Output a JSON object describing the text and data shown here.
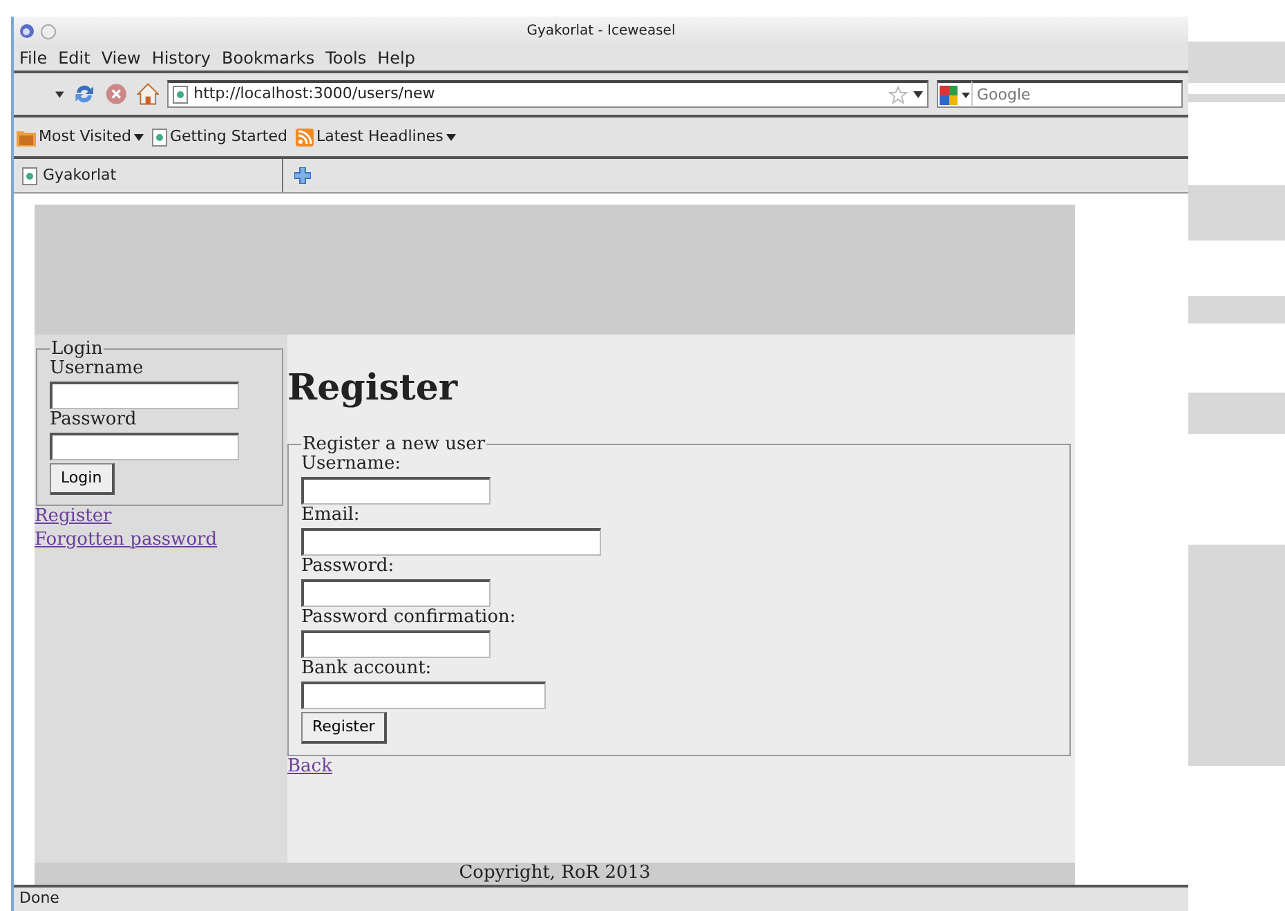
{
  "window": {
    "title": "Gyakorlat - Iceweasel"
  },
  "menu": [
    "File",
    "Edit",
    "View",
    "History",
    "Bookmarks",
    "Tools",
    "Help"
  ],
  "navigation": {
    "url": "http://localhost:3000/users/new",
    "search_placeholder": "Google"
  },
  "bookmarks": [
    {
      "label": "Most Visited",
      "kind": "folder",
      "dropdown": true
    },
    {
      "label": "Getting Started",
      "kind": "page",
      "dropdown": false
    },
    {
      "label": "Latest Headlines",
      "kind": "feed",
      "dropdown": true
    }
  ],
  "tabs": [
    {
      "label": "Gyakorlat",
      "selected": true
    }
  ],
  "sidebar": {
    "login": {
      "legend": "Login",
      "fields": [
        "Username",
        "Password"
      ],
      "button": "Login"
    },
    "links": [
      "Register",
      "Forgotten password"
    ]
  },
  "main": {
    "heading": "Register",
    "legend": "Register a new user",
    "fields": [
      "Username:",
      "Email:",
      "Password:",
      "Password confirmation:",
      "Bank account:"
    ],
    "button": "Register",
    "back_link": "Back"
  },
  "footer": "Copyright, RoR 2013",
  "status_bar": "Done"
}
